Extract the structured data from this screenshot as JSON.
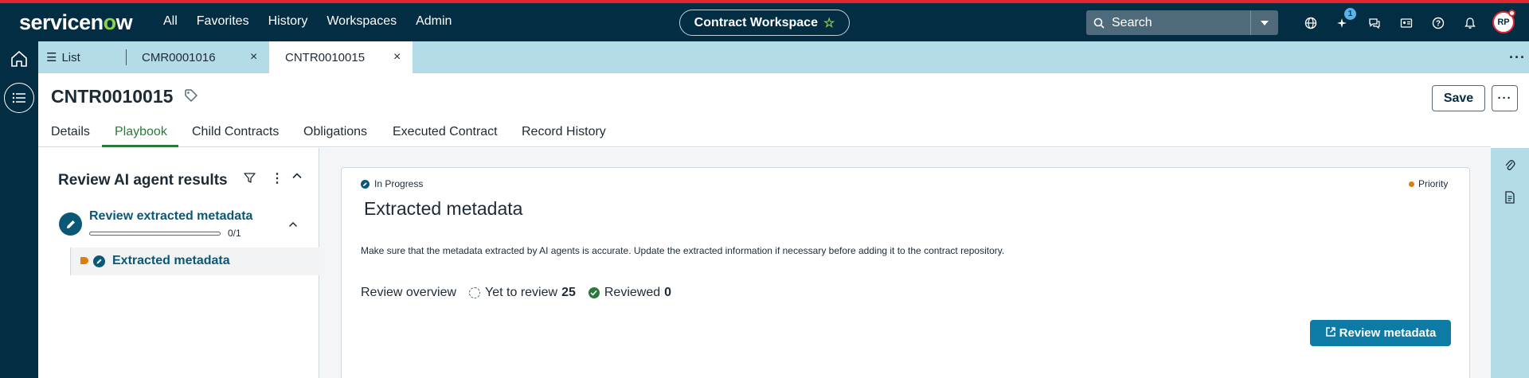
{
  "topnav": {
    "logo_service": "servicen",
    "logo_now": "o",
    "logo_w": "w",
    "menu": [
      "All",
      "Favorites",
      "History",
      "Workspaces",
      "Admin"
    ],
    "workspace": "Contract Workspace",
    "search_placeholder": "Search",
    "notification_badge": "1",
    "avatar_initials": "RP"
  },
  "tabs": {
    "list_label": "List",
    "items": [
      {
        "label": "CMR0001016"
      },
      {
        "label": "CNTR0010015"
      }
    ]
  },
  "record": {
    "number": "CNTR0010015",
    "save_label": "Save"
  },
  "subtabs": [
    "Details",
    "Playbook",
    "Child Contracts",
    "Obligations",
    "Executed Contract",
    "Record History"
  ],
  "left_panel": {
    "title": "Review AI agent results",
    "step_title": "Review extracted metadata",
    "step_progress": "0/1",
    "progress_fraction": 0,
    "substep_label": "Extracted metadata"
  },
  "card": {
    "status": "In Progress",
    "priority": "Priority",
    "title": "Extracted metadata",
    "description": "Make sure that the metadata extracted by AI agents is accurate. Update the extracted information if necessary before adding it to the contract repository.",
    "overview_label": "Review overview",
    "pending_label": "Yet to review",
    "pending_count": "25",
    "reviewed_label": "Reviewed",
    "reviewed_count": "0",
    "action_label": "Review metadata"
  },
  "colors": {
    "nav_bg": "#032d42",
    "accent_green": "#2b7a3b",
    "primary_button": "#0e7ba6",
    "priority_orange": "#e07b0e",
    "tabstrip_bg": "#b3dbe8"
  }
}
